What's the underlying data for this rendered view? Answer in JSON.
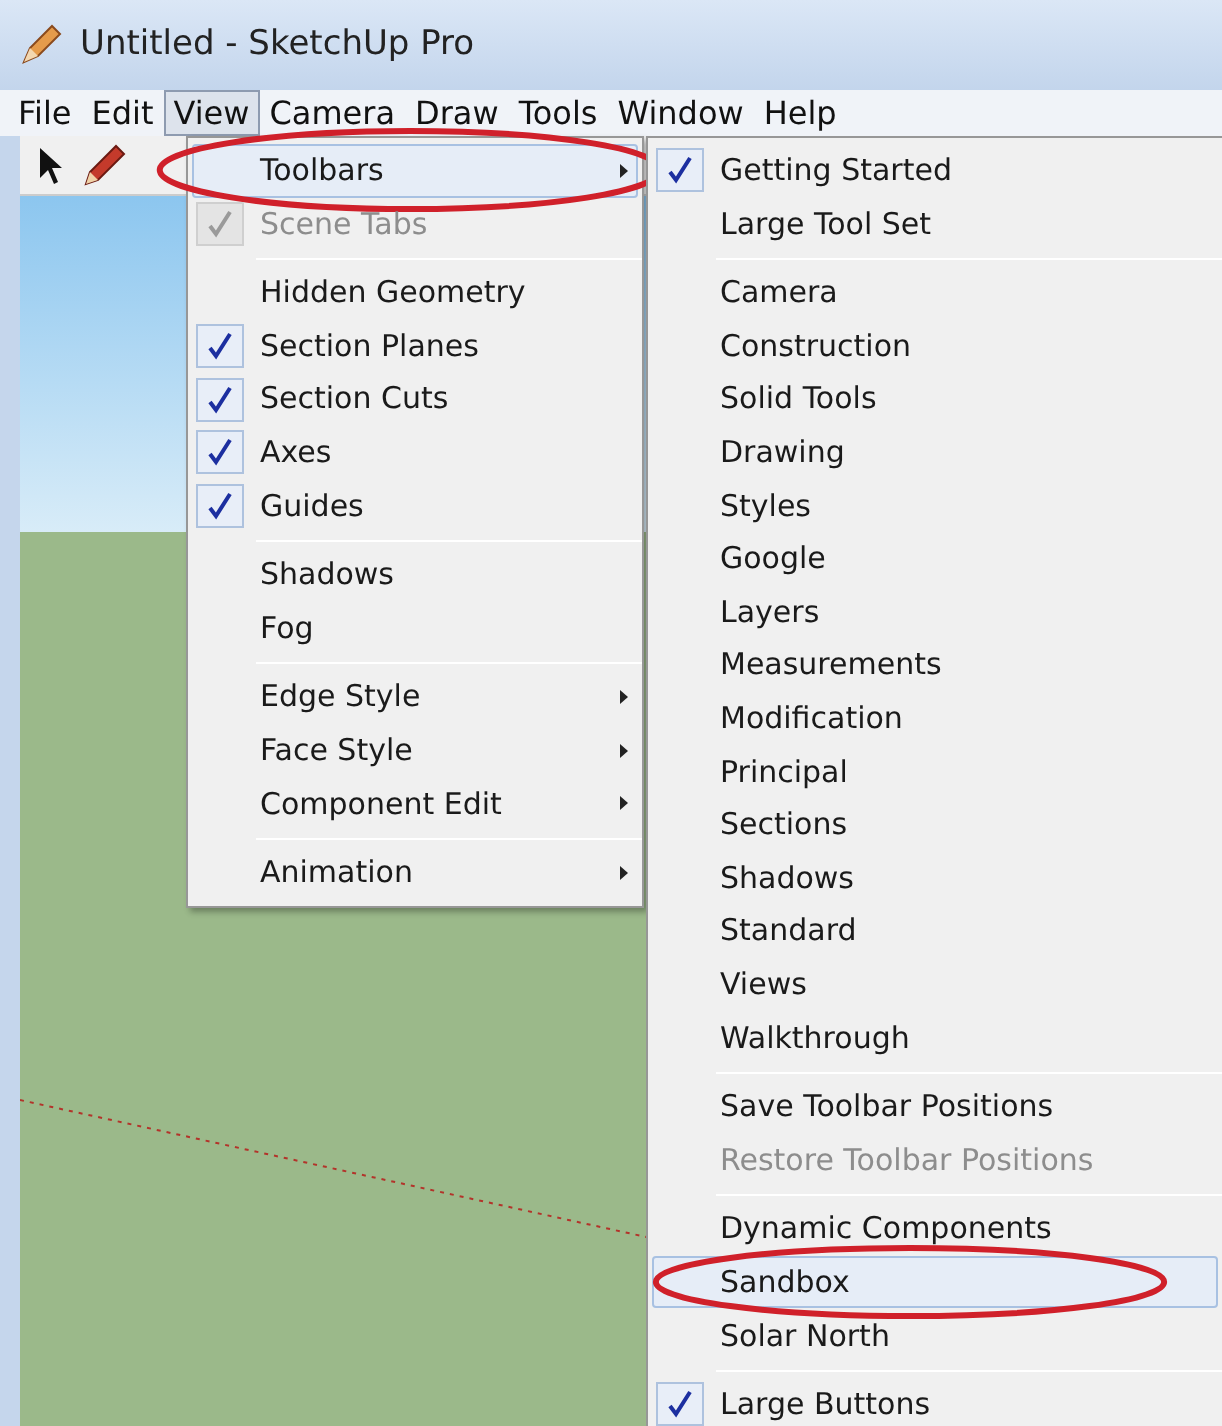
{
  "window": {
    "title": "Untitled - SketchUp Pro"
  },
  "menubar": [
    {
      "label": "File",
      "selected": false
    },
    {
      "label": "Edit",
      "selected": false
    },
    {
      "label": "View",
      "selected": true
    },
    {
      "label": "Camera",
      "selected": false
    },
    {
      "label": "Draw",
      "selected": false
    },
    {
      "label": "Tools",
      "selected": false
    },
    {
      "label": "Window",
      "selected": false
    },
    {
      "label": "Help",
      "selected": false
    }
  ],
  "view_menu": [
    {
      "kind": "item",
      "label": "Toolbars",
      "checked": false,
      "disabled": false,
      "submenu": true,
      "selected": true,
      "circled": true
    },
    {
      "kind": "item",
      "label": "Scene Tabs",
      "checked": true,
      "disabled": true,
      "submenu": false,
      "selected": false,
      "circled": false
    },
    {
      "kind": "separator"
    },
    {
      "kind": "item",
      "label": "Hidden Geometry",
      "checked": false,
      "disabled": false,
      "submenu": false,
      "selected": false,
      "circled": false
    },
    {
      "kind": "item",
      "label": "Section Planes",
      "checked": true,
      "disabled": false,
      "submenu": false,
      "selected": false,
      "circled": false
    },
    {
      "kind": "item",
      "label": "Section Cuts",
      "checked": true,
      "disabled": false,
      "submenu": false,
      "selected": false,
      "circled": false
    },
    {
      "kind": "item",
      "label": "Axes",
      "checked": true,
      "disabled": false,
      "submenu": false,
      "selected": false,
      "circled": false
    },
    {
      "kind": "item",
      "label": "Guides",
      "checked": true,
      "disabled": false,
      "submenu": false,
      "selected": false,
      "circled": false
    },
    {
      "kind": "separator"
    },
    {
      "kind": "item",
      "label": "Shadows",
      "checked": false,
      "disabled": false,
      "submenu": false,
      "selected": false,
      "circled": false
    },
    {
      "kind": "item",
      "label": "Fog",
      "checked": false,
      "disabled": false,
      "submenu": false,
      "selected": false,
      "circled": false
    },
    {
      "kind": "separator"
    },
    {
      "kind": "item",
      "label": "Edge Style",
      "checked": false,
      "disabled": false,
      "submenu": true,
      "selected": false,
      "circled": false
    },
    {
      "kind": "item",
      "label": "Face Style",
      "checked": false,
      "disabled": false,
      "submenu": true,
      "selected": false,
      "circled": false
    },
    {
      "kind": "item",
      "label": "Component Edit",
      "checked": false,
      "disabled": false,
      "submenu": true,
      "selected": false,
      "circled": false
    },
    {
      "kind": "separator"
    },
    {
      "kind": "item",
      "label": "Animation",
      "checked": false,
      "disabled": false,
      "submenu": true,
      "selected": false,
      "circled": false
    }
  ],
  "toolbars_menu": [
    {
      "kind": "item",
      "label": "Getting Started",
      "checked": true,
      "disabled": false,
      "selected": false,
      "circled": false
    },
    {
      "kind": "item",
      "label": "Large Tool Set",
      "checked": false,
      "disabled": false,
      "selected": false,
      "circled": false
    },
    {
      "kind": "separator"
    },
    {
      "kind": "item",
      "label": "Camera",
      "checked": false,
      "disabled": false,
      "selected": false,
      "circled": false
    },
    {
      "kind": "item",
      "label": "Construction",
      "checked": false,
      "disabled": false,
      "selected": false,
      "circled": false
    },
    {
      "kind": "item",
      "label": "Solid Tools",
      "checked": false,
      "disabled": false,
      "selected": false,
      "circled": false
    },
    {
      "kind": "item",
      "label": "Drawing",
      "checked": false,
      "disabled": false,
      "selected": false,
      "circled": false
    },
    {
      "kind": "item",
      "label": "Styles",
      "checked": false,
      "disabled": false,
      "selected": false,
      "circled": false
    },
    {
      "kind": "item",
      "label": "Google",
      "checked": false,
      "disabled": false,
      "selected": false,
      "circled": false
    },
    {
      "kind": "item",
      "label": "Layers",
      "checked": false,
      "disabled": false,
      "selected": false,
      "circled": false
    },
    {
      "kind": "item",
      "label": "Measurements",
      "checked": false,
      "disabled": false,
      "selected": false,
      "circled": false
    },
    {
      "kind": "item",
      "label": "Modification",
      "checked": false,
      "disabled": false,
      "selected": false,
      "circled": false
    },
    {
      "kind": "item",
      "label": "Principal",
      "checked": false,
      "disabled": false,
      "selected": false,
      "circled": false
    },
    {
      "kind": "item",
      "label": "Sections",
      "checked": false,
      "disabled": false,
      "selected": false,
      "circled": false
    },
    {
      "kind": "item",
      "label": "Shadows",
      "checked": false,
      "disabled": false,
      "selected": false,
      "circled": false
    },
    {
      "kind": "item",
      "label": "Standard",
      "checked": false,
      "disabled": false,
      "selected": false,
      "circled": false
    },
    {
      "kind": "item",
      "label": "Views",
      "checked": false,
      "disabled": false,
      "selected": false,
      "circled": false
    },
    {
      "kind": "item",
      "label": "Walkthrough",
      "checked": false,
      "disabled": false,
      "selected": false,
      "circled": false
    },
    {
      "kind": "separator"
    },
    {
      "kind": "item",
      "label": "Save Toolbar Positions",
      "checked": false,
      "disabled": false,
      "selected": false,
      "circled": false
    },
    {
      "kind": "item",
      "label": "Restore Toolbar Positions",
      "checked": false,
      "disabled": true,
      "selected": false,
      "circled": false
    },
    {
      "kind": "separator"
    },
    {
      "kind": "item",
      "label": "Dynamic Components",
      "checked": false,
      "disabled": false,
      "selected": false,
      "circled": false
    },
    {
      "kind": "item",
      "label": "Sandbox",
      "checked": false,
      "disabled": false,
      "selected": true,
      "circled": true
    },
    {
      "kind": "item",
      "label": "Solar North",
      "checked": false,
      "disabled": false,
      "selected": false,
      "circled": false
    },
    {
      "kind": "separator"
    },
    {
      "kind": "item",
      "label": "Large Buttons",
      "checked": true,
      "disabled": false,
      "selected": false,
      "circled": false
    }
  ]
}
